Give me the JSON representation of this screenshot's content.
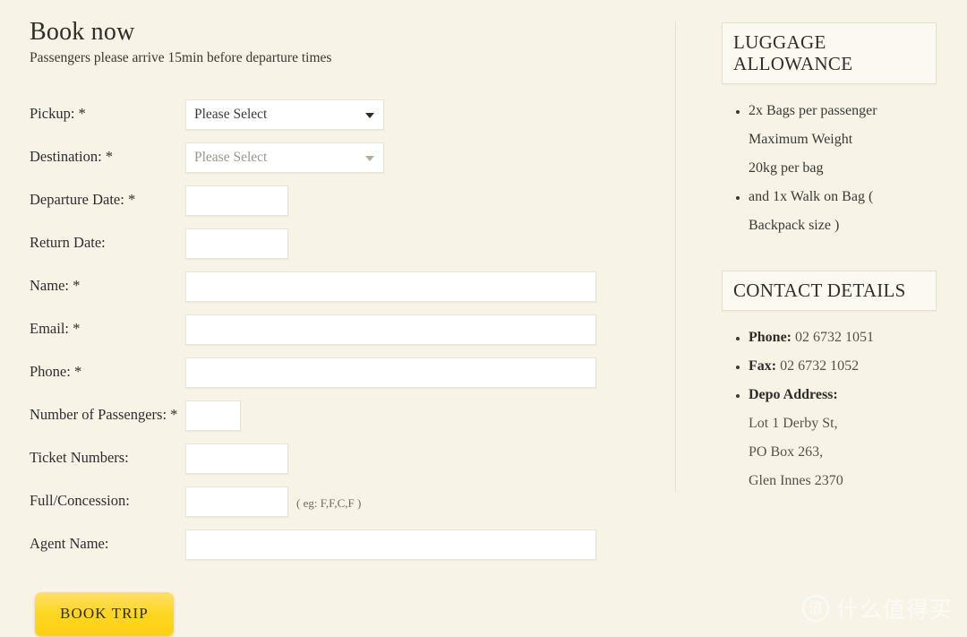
{
  "form": {
    "title": "Book now",
    "subtitle": "Passengers please arrive 15min before departure times",
    "submit_label": "BOOK TRIP",
    "hint_concession": "( eg: F,F,C,F )",
    "fields": {
      "pickup": {
        "label": "Pickup: *",
        "value": "Please Select"
      },
      "destination": {
        "label": "Destination: *",
        "value": "Please Select"
      },
      "departure_date": {
        "label": "Departure Date: *",
        "value": ""
      },
      "return_date": {
        "label": "Return Date:",
        "value": ""
      },
      "name": {
        "label": "Name: *",
        "value": ""
      },
      "email": {
        "label": "Email: *",
        "value": ""
      },
      "phone": {
        "label": "Phone: *",
        "value": ""
      },
      "passengers": {
        "label": "Number of Passengers: *",
        "value": ""
      },
      "ticket_numbers": {
        "label": "Ticket Numbers:",
        "value": ""
      },
      "full_concession": {
        "label": "Full/Concession:",
        "value": ""
      },
      "agent_name": {
        "label": "Agent Name:",
        "value": ""
      }
    }
  },
  "sidebar": {
    "luggage": {
      "title_line1": "LUGGAGE",
      "title_line2": "ALLOWANCE",
      "items": [
        {
          "line1": "2x Bags per passenger",
          "line2": "Maximum Weight",
          "line3": "20kg per bag"
        },
        {
          "line1": "and 1x Walk on Bag (",
          "line2": "Backpack size )",
          "line3": ""
        }
      ]
    },
    "contact": {
      "title": "CONTACT DETAILS",
      "phone_label": "Phone:",
      "phone_value": "02 6732 1051",
      "fax_label": "Fax:",
      "fax_value": "02 6732 1052",
      "address_label": "Depo Address:",
      "address_line1": "Lot 1 Derby St,",
      "address_line2": "PO Box 263,",
      "address_line3": "Glen Innes 2370"
    }
  },
  "watermark": {
    "badge": "值",
    "text": "什么值得买"
  }
}
